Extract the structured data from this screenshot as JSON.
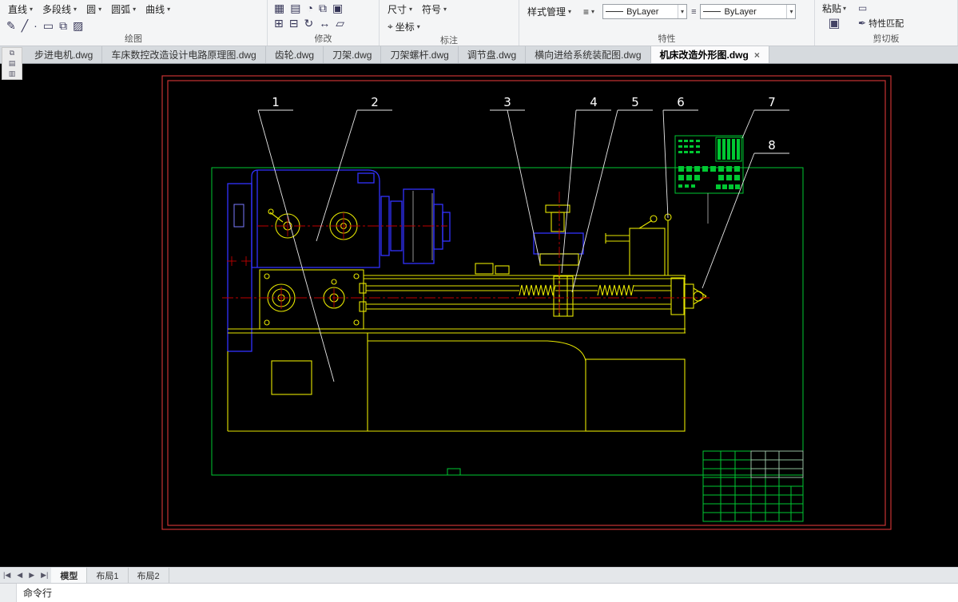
{
  "colors": {
    "frame-red": "#c83232",
    "sheet-green": "#00c832",
    "entity-blue": "#3232ff",
    "entity-yellow": "#e6e600",
    "centerline-red": "#c00000",
    "drawing-white": "#e8e8e8",
    "canvas-bg": "#000000",
    "ribbon-bg": "#f4f5f6",
    "tabbar-bg": "#d6dade",
    "active-tab-bg": "#fbfbfc"
  },
  "icons": {
    "caret": "▾",
    "close": "×",
    "pencil": "✎",
    "line": "╱",
    "point": "·",
    "rect": "▭",
    "copy": "⧉",
    "hatch": "▨",
    "grid": "▦",
    "rows": "▤",
    "clock": "◔",
    "pane": "▣",
    "plus-box": "⊞",
    "minus-box": "⊟",
    "rotate": "↻",
    "resize": "↔",
    "skew": "▱",
    "target": "⌖",
    "menu": "≡",
    "brush": "✒",
    "clipboard": "▣",
    "panel-a": "⧉",
    "panel-b": "▤",
    "panel-c": "▥"
  },
  "ribbon": {
    "draw": {
      "label": "绘图",
      "tools": [
        "直线",
        "多段线",
        "圆",
        "圆弧",
        "曲线"
      ]
    },
    "modify": {
      "label": "修改"
    },
    "annotate": {
      "label": "标注",
      "dimension": "尺寸",
      "symbol": "符号",
      "coordinate": "坐标"
    },
    "properties": {
      "label": "特性",
      "style_manager": "样式管理",
      "layer_value": "ByLayer",
      "color_value": "ByLayer"
    },
    "clipboard": {
      "label": "剪切板",
      "paste": "粘贴",
      "match_properties": "特性匹配"
    }
  },
  "file_tabs": [
    {
      "label": "步进电机.dwg"
    },
    {
      "label": "车床数控改造设计电路原理图.dwg"
    },
    {
      "label": "齿轮.dwg"
    },
    {
      "label": "刀架.dwg"
    },
    {
      "label": "刀架螺杆.dwg"
    },
    {
      "label": "调节盘.dwg"
    },
    {
      "label": "横向进给系统装配图.dwg"
    },
    {
      "label": "机床改造外形图.dwg",
      "active": true
    }
  ],
  "drawing": {
    "callouts": [
      "1",
      "2",
      "3",
      "4",
      "5",
      "6",
      "7",
      "8"
    ]
  },
  "layout_bar": {
    "nav": [
      "|◀",
      "◀",
      "▶",
      "▶|"
    ],
    "tabs": [
      "模型",
      "布局1",
      "布局2"
    ]
  },
  "command_line": {
    "label": "命令行"
  }
}
